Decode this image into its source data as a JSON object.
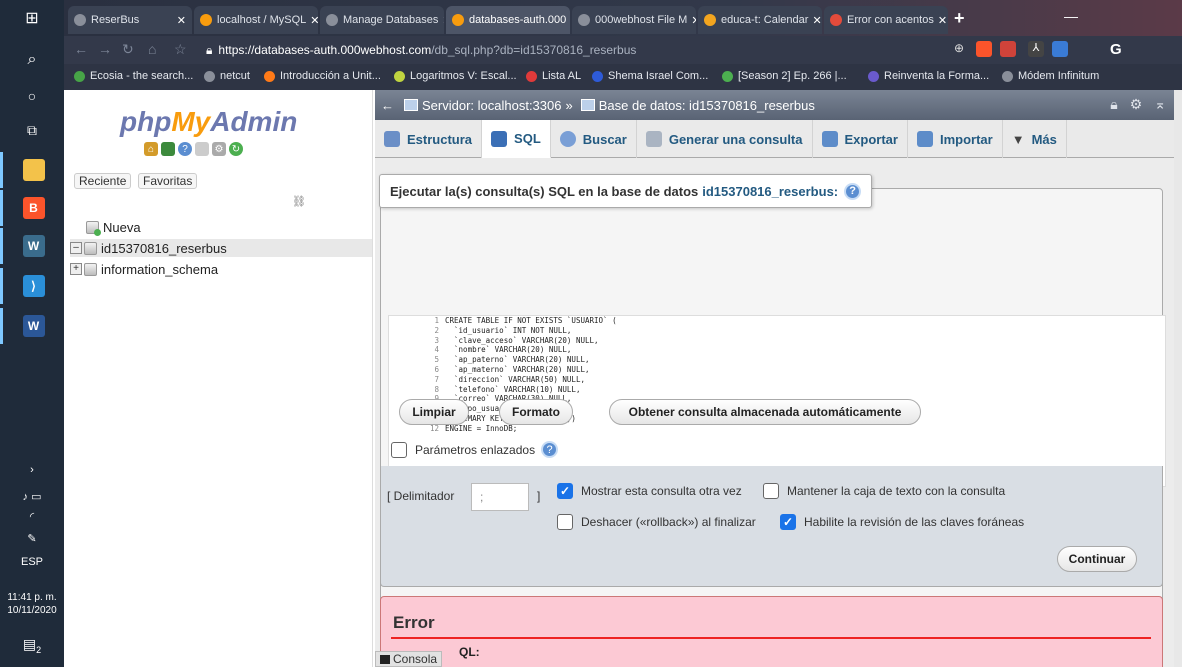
{
  "taskbar": {
    "language": "ESP",
    "time": "11:41 p. m.",
    "date": "10/11/2020",
    "notification_count": "2"
  },
  "browser": {
    "tabs": [
      {
        "label": "ReserBus",
        "favicon_color": "#8a8f9a"
      },
      {
        "label": "localhost / MySQL",
        "favicon_color": "#f89c0e"
      },
      {
        "label": "Manage Databases",
        "favicon_color": "#8a8f9a"
      },
      {
        "label": "databases-auth.000",
        "favicon_color": "#f89c0e"
      },
      {
        "label": "000webhost File M",
        "favicon_color": "#8a8f9a"
      },
      {
        "label": "educa-t: Calendar",
        "favicon_color": "#f3a51f"
      },
      {
        "label": "Error con acentos",
        "favicon_color": "#e34b3b"
      }
    ],
    "url_host": "https://databases-auth.000webhost.com",
    "url_path": "/db_sql.php?db=id15370816_reserbus",
    "bookmarks": [
      {
        "label": "Ecosia - the search...",
        "color": "#47a447"
      },
      {
        "label": "netcut",
        "color": "#8a8f9a"
      },
      {
        "label": "Introducción a Unit...",
        "color": "#ff7a18"
      },
      {
        "label": "Logaritmos V: Escal...",
        "color": "#c0d440"
      },
      {
        "label": "Lista AL",
        "color": "#e03a3a"
      },
      {
        "label": "Shema Israel Com...",
        "color": "#2e5bd8"
      },
      {
        "label": "[Season 2] Ep. 266 |...",
        "color": "#4caf50"
      },
      {
        "label": "Reinventa la Forma...",
        "color": "#6a5acd"
      },
      {
        "label": "Módem Infinitum",
        "color": "#8a8f9a"
      }
    ]
  },
  "left_panel": {
    "logo_php": "php",
    "logo_my": "My",
    "logo_admin": "Admin",
    "recent_tab": "Reciente",
    "favorites_tab": "Favoritas",
    "tree": [
      {
        "label": "Nueva"
      },
      {
        "label": "id15370816_reserbus"
      },
      {
        "label": "information_schema"
      }
    ]
  },
  "main": {
    "breadcrumb_server": "Servidor: localhost:3306",
    "breadcrumb_db": "Base de datos: id15370816_reserbus",
    "tabs": [
      {
        "label": "Estructura",
        "icon_color": "#6b8fc7"
      },
      {
        "label": "SQL",
        "icon_color": "#3b6fb6"
      },
      {
        "label": "Buscar",
        "icon_color": "#7a9fd6"
      },
      {
        "label": "Generar una consulta",
        "icon_color": "#aab4c2"
      },
      {
        "label": "Exportar",
        "icon_color": "#5d8cc9"
      },
      {
        "label": "Importar",
        "icon_color": "#5d8cc9"
      },
      {
        "label": "Más",
        "icon_color": "#444444"
      }
    ],
    "sql_title": "Ejecutar la(s) consulta(s) SQL en la base de datos",
    "sql_db": "id15370816_reserbus:",
    "sql_lines": [
      "CREATE TABLE IF NOT EXISTS `USUARIO` (",
      "  `id_usuario` INT NOT NULL,",
      "  `clave_acceso` VARCHAR(20) NULL,",
      "  `nombre` VARCHAR(20) NULL,",
      "  `ap_paterno` VARCHAR(20) NULL,",
      "  `ap_materno` VARCHAR(20) NULL,",
      "  `direccion` VARCHAR(50) NULL,",
      "  `telefono` VARCHAR(10) NULL,",
      "  `correo` VARCHAR(30) NULL,",
      "  `tipo_usuario` INT NULL,",
      "  PRIMARY KEY (`id_usuario`))",
      "ENGINE = InnoDB;"
    ],
    "btn_clear": "Limpiar",
    "btn_format": "Formato",
    "btn_stored": "Obtener consulta almacenada automáticamente",
    "bind_params": "Parámetros enlazados",
    "delimiter_label": "[ Delimitador",
    "delimiter_close": "]",
    "delimiter_value": ";",
    "opt_show_query": "Mostrar esta consulta otra vez",
    "opt_keep_box": "Mantener la caja de texto con la consulta",
    "opt_rollback": "Deshacer («rollback») al finalizar",
    "opt_fk_check": "Habilite la revisión de las claves foráneas",
    "btn_go": "Continuar",
    "error_title": "Error",
    "error_sql_label": "QL:",
    "console_label": "Consola"
  }
}
